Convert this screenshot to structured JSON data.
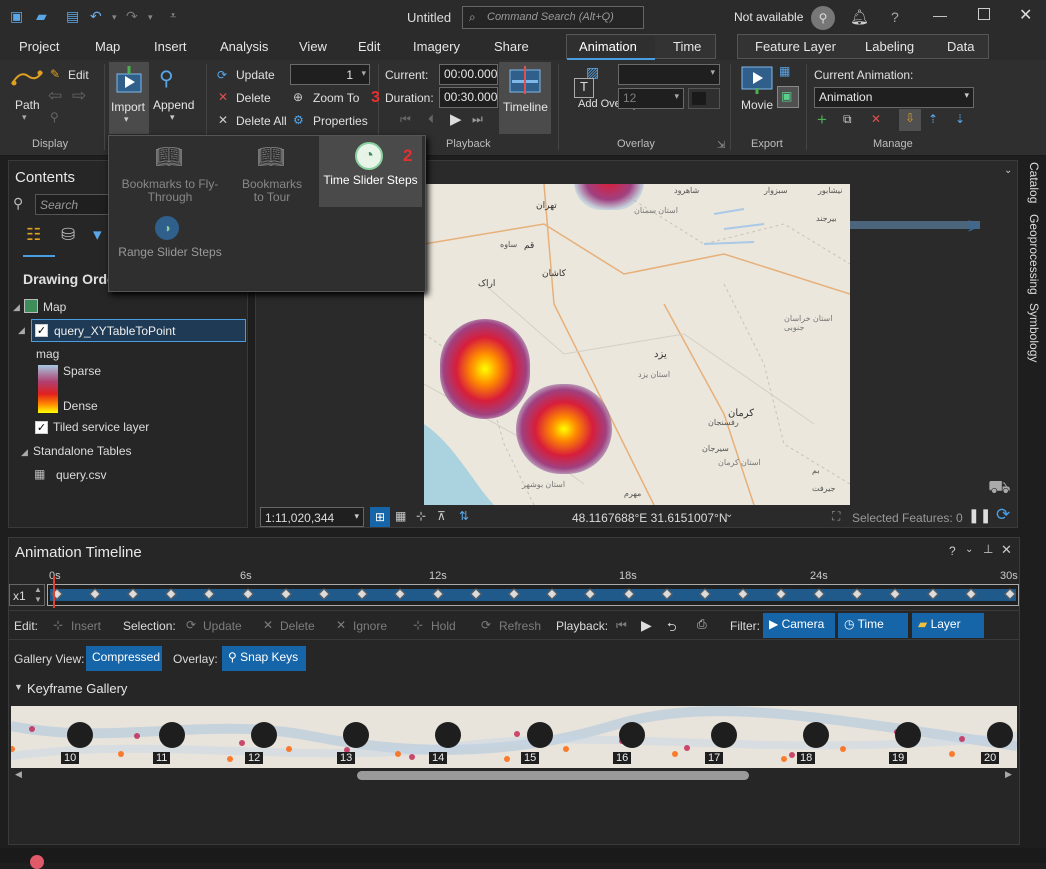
{
  "window": {
    "title": "Untitled",
    "search_placeholder": "Command Search (Alt+Q)",
    "account": "Not available",
    "help": "?"
  },
  "tabs": [
    "Project",
    "Map",
    "Insert",
    "Analysis",
    "View",
    "Edit",
    "Imagery",
    "Share",
    "Animation",
    "Time"
  ],
  "context_tabs": [
    "Feature Layer",
    "Labeling",
    "Data"
  ],
  "ribbon": {
    "display": {
      "path": "Path",
      "edit": "Edit",
      "group": "Display"
    },
    "import": {
      "import": "Import",
      "append": "Append"
    },
    "keyframes": {
      "update": "Update",
      "delete": "Delete",
      "delete_all": "Delete All",
      "zoom_to": "Zoom To",
      "properties": "Properties",
      "spin_value": "1"
    },
    "playback": {
      "current_label": "Current:",
      "current_value": "00:00.000",
      "duration_label": "Duration:",
      "duration_value": "00:30.000",
      "timeline": "Timeline",
      "group": "Playback",
      "marker": "3"
    },
    "overlay": {
      "add_overlay": "Add Overlay",
      "font_size": "12",
      "group": "Overlay"
    },
    "export": {
      "movie": "Movie",
      "group": "Export"
    },
    "manage": {
      "current_label": "Current Animation:",
      "current_value": "Animation",
      "group": "Manage"
    }
  },
  "import_menu": {
    "items": [
      "Bookmarks to Fly-Through",
      "Bookmarks to Tour",
      "Time Slider Steps",
      "Range Slider Steps"
    ],
    "marker": "2"
  },
  "contents": {
    "title": "Contents",
    "search_placeholder": "Search",
    "drawing_order": "Drawing Orde",
    "map": "Map",
    "layer": "query_XYTableToPoint",
    "field": "mag",
    "sparse": "Sparse",
    "dense": "Dense",
    "basemap": "Tiled service layer",
    "standalone": "Standalone Tables",
    "table": "query.csv"
  },
  "map": {
    "scale": "1:11,020,344",
    "coords": "48.1167688°E 31.6151007°N",
    "selected": "Selected Features: 0",
    "labels": [
      "تهران",
      "قم",
      "کاشان",
      "اراک",
      "ساوه",
      "یزد",
      "کرمان",
      "رفسنجان",
      "سیرجان",
      "شاهرود",
      "سبزوار",
      "نیشابور",
      "بیرجند",
      "استان کرمان",
      "استان یزد",
      "استان سمنان",
      "استان خراسان جنوبی",
      "جیرفت",
      "بم",
      "مهرم",
      "استان بوشهر"
    ]
  },
  "right_tabs": [
    "Catalog",
    "Geoprocessing",
    "Symbology"
  ],
  "timeline": {
    "title": "Animation Timeline",
    "ticks": [
      "0s",
      "6s",
      "12s",
      "18s",
      "24s",
      "30s"
    ],
    "speed": "x1"
  },
  "edit_bar": {
    "edit": "Edit:",
    "insert": "Insert",
    "selection": "Selection:",
    "update": "Update",
    "delete": "Delete",
    "ignore": "Ignore",
    "hold": "Hold",
    "refresh": "Refresh",
    "playback": "Playback:",
    "filter": "Filter:",
    "camera": "Camera",
    "time": "Time",
    "layer": "Layer"
  },
  "gallery_bar": {
    "gallery_view": "Gallery View:",
    "compressed": "Compressed",
    "overlay": "Overlay:",
    "snap_keys": "Snap Keys"
  },
  "gallery": {
    "title": "Keyframe Gallery",
    "frames": [
      "10",
      "11",
      "12",
      "13",
      "14",
      "15",
      "16",
      "17",
      "18",
      "19",
      "20"
    ]
  }
}
